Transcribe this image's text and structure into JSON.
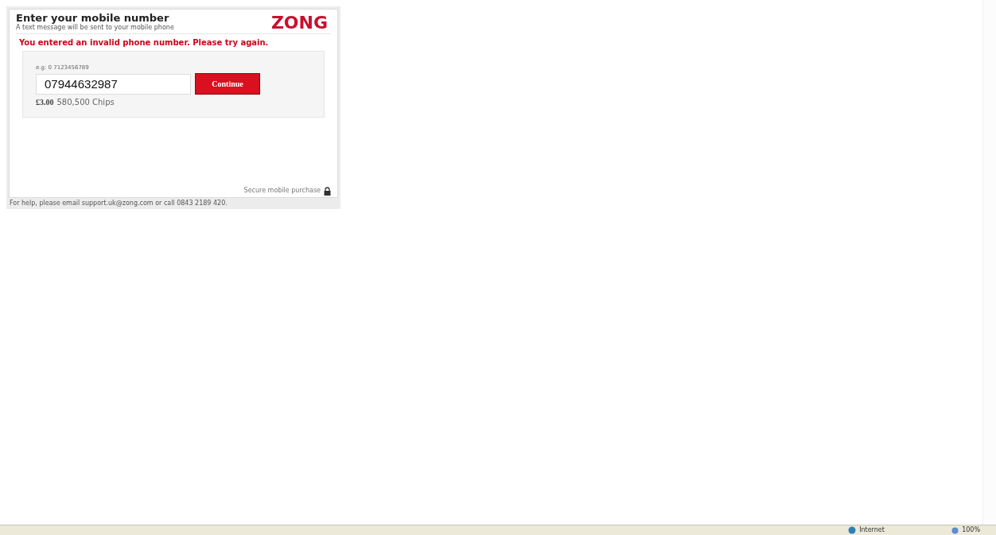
{
  "widget": {
    "title": "Enter your mobile number",
    "subtitle": "A text message will be sent to your mobile phone",
    "logo": "ZONG",
    "error": "You entered an invalid phone number. Please try again.",
    "hint": "e.g: 0 7123456789",
    "phone_value": "07944632987",
    "continue_button": "Continue",
    "price": "£3.00",
    "package": "580,500 Chips",
    "secure_note": "Secure mobile purchase",
    "help": "For help, please email support.uk@zong.com or call 0843 2189 420."
  },
  "status_bar": {
    "zone": "Internet",
    "zoom": "100%"
  }
}
